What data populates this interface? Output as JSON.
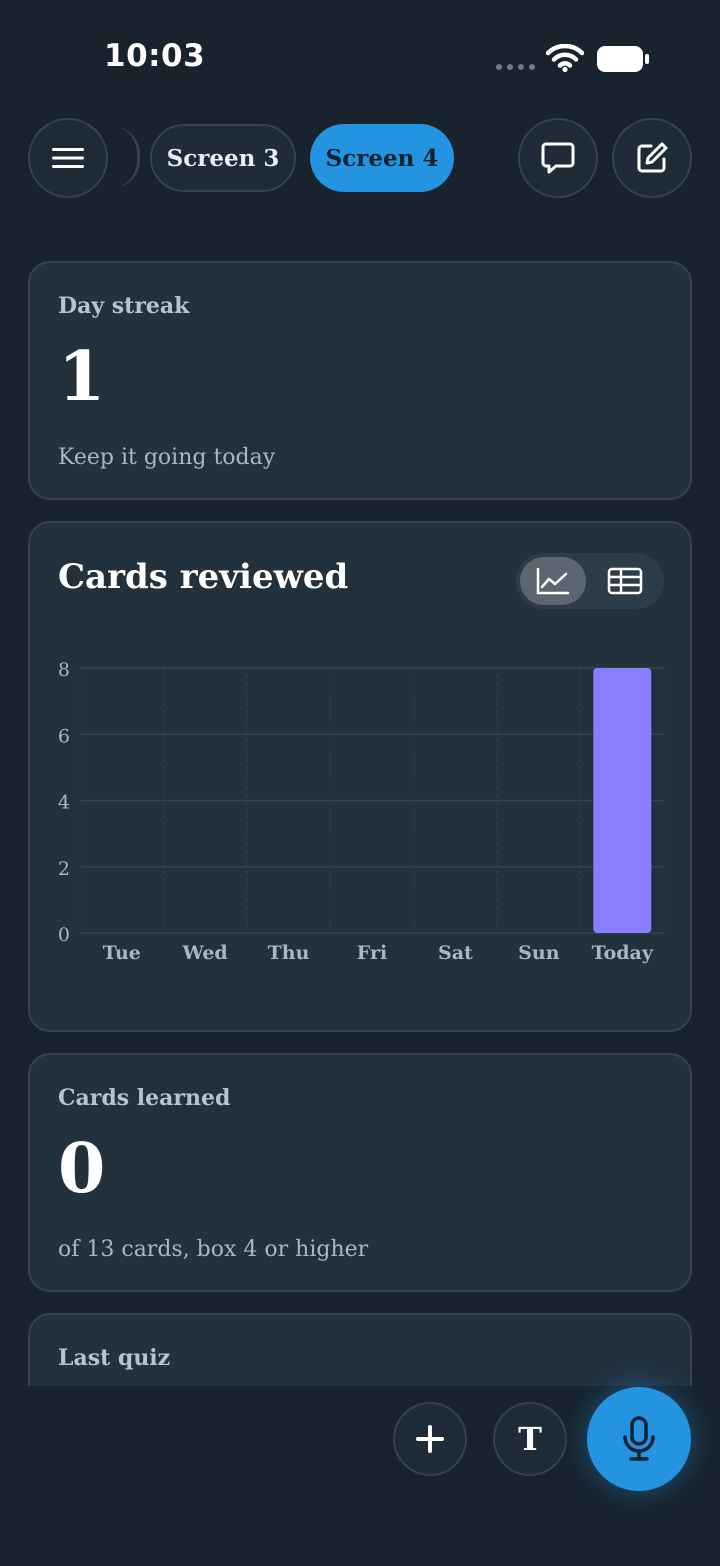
{
  "status_bar": {
    "time": "10:03"
  },
  "nav": {
    "tabs": [
      {
        "label": "Screen 3",
        "active": false
      },
      {
        "label": "Screen 4",
        "active": true
      }
    ]
  },
  "day_streak": {
    "label": "Day streak",
    "value": "1",
    "subtitle": "Keep it going today"
  },
  "cards_reviewed": {
    "title": "Cards reviewed",
    "view_toggle": {
      "selected": "chart",
      "options": [
        "chart",
        "table"
      ]
    }
  },
  "chart_data": {
    "type": "bar",
    "categories": [
      "Tue",
      "Wed",
      "Thu",
      "Fri",
      "Sat",
      "Sun",
      "Today"
    ],
    "values": [
      0,
      0,
      0,
      0,
      0,
      0,
      8
    ],
    "yticks": [
      "0",
      "2",
      "4",
      "6",
      "8"
    ],
    "ylim": [
      0,
      8
    ],
    "grid": true,
    "bar_color": "#8a7dff"
  },
  "cards_learned": {
    "label": "Cards learned",
    "value": "0",
    "subtitle": "of 13 cards, box 4 or higher"
  },
  "last_quiz": {
    "label": "Last quiz"
  },
  "bottom_bar": {
    "text_button": "T"
  },
  "colors": {
    "background": "#18232d",
    "card": "#23313d",
    "accent": "#2493e0",
    "bar": "#8a7dff"
  }
}
